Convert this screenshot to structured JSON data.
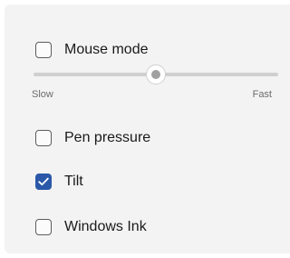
{
  "options": {
    "mouse_mode": {
      "label": "Mouse mode",
      "checked": false
    },
    "pen_pressure": {
      "label": "Pen pressure",
      "checked": false
    },
    "tilt": {
      "label": "Tilt",
      "checked": true
    },
    "windows_ink": {
      "label": "Windows Ink",
      "checked": false
    }
  },
  "slider": {
    "min_label": "Slow",
    "max_label": "Fast",
    "value_fraction": 0.5
  },
  "colors": {
    "accent": "#2b58a8",
    "panel_background": "#f3f3f3"
  }
}
